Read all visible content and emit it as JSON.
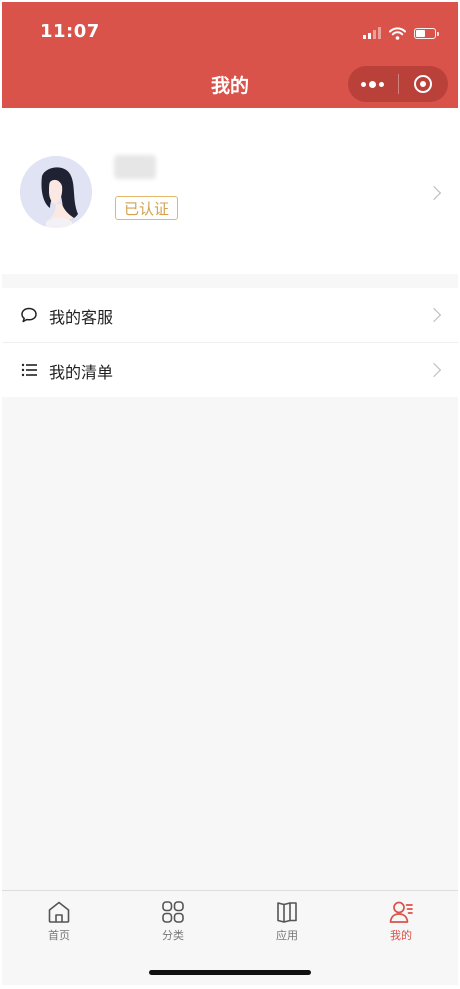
{
  "status_bar": {
    "time": "11:07",
    "battery_level": 0.55
  },
  "header": {
    "title": "我的",
    "more_icon": "more-dots-icon",
    "close_icon": "target-icon"
  },
  "profile": {
    "verified_badge": "已认证"
  },
  "menu": [
    {
      "label": "我的客服",
      "icon": "chat-bubble-icon"
    },
    {
      "label": "我的清单",
      "icon": "list-icon"
    }
  ],
  "tabs": [
    {
      "label": "首页",
      "icon": "home-icon",
      "active": false
    },
    {
      "label": "分类",
      "icon": "category-grid-icon",
      "active": false
    },
    {
      "label": "应用",
      "icon": "book-icon",
      "active": false
    },
    {
      "label": "我的",
      "icon": "user-icon",
      "active": true
    }
  ],
  "colors": {
    "accent": "#d9534a",
    "badge": "#d4a24c",
    "background": "#f7f7f7"
  }
}
